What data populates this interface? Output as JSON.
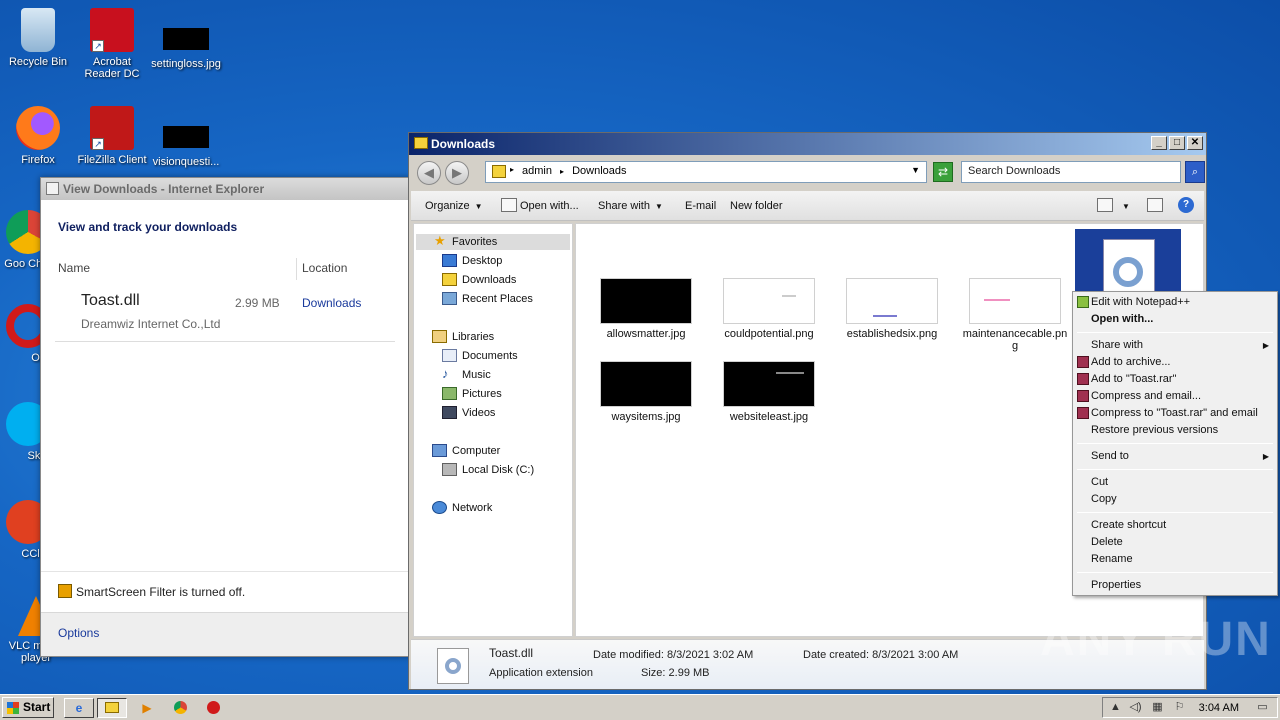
{
  "desktop": {
    "icons": [
      {
        "label": "Recycle Bin"
      },
      {
        "label": "Acrobat Reader DC"
      },
      {
        "label": "settingloss.jpg"
      },
      {
        "label": "Firefox"
      },
      {
        "label": "FileZilla Client"
      },
      {
        "label": "visionquesti..."
      },
      {
        "label": "Goo Chro"
      },
      {
        "label": "Ope"
      },
      {
        "label": "Skyp"
      },
      {
        "label": "CClea"
      },
      {
        "label": "VLC media player"
      }
    ]
  },
  "ie_window": {
    "title": "View Downloads - Internet Explorer",
    "heading": "View and track your downloads",
    "col_name": "Name",
    "col_location": "Location",
    "item": {
      "name": "Toast.dll",
      "size": "2.99 MB",
      "location": "Downloads",
      "publisher": "Dreamwiz Internet Co.,Ltd"
    },
    "smartscreen": "SmartScreen Filter is turned off.",
    "options": "Options"
  },
  "explorer": {
    "title": "Downloads",
    "breadcrumb": [
      "admin",
      "Downloads"
    ],
    "search_placeholder": "Search Downloads",
    "toolbar": {
      "organize": "Organize",
      "open_with": "Open with...",
      "share_with": "Share with",
      "email": "E-mail",
      "new_folder": "New folder"
    },
    "nav": {
      "favorites": "Favorites",
      "desktop": "Desktop",
      "downloads": "Downloads",
      "recent": "Recent Places",
      "libraries": "Libraries",
      "documents": "Documents",
      "music": "Music",
      "pictures": "Pictures",
      "videos": "Videos",
      "computer": "Computer",
      "local_disk": "Local Disk (C:)",
      "network": "Network"
    },
    "files": [
      {
        "name": "allowsmatter.jpg"
      },
      {
        "name": "couldpotential.png"
      },
      {
        "name": "establishedsix.png"
      },
      {
        "name": "maintenancecable.png"
      },
      {
        "name": "waysitems.jpg"
      },
      {
        "name": "websiteleast.jpg"
      }
    ],
    "details": {
      "name": "Toast.dll",
      "type": "Application extension",
      "modified_label": "Date modified:",
      "modified": "8/3/2021 3:02 AM",
      "created_label": "Date created:",
      "created": "8/3/2021 3:00 AM",
      "size_label": "Size:",
      "size": "2.99 MB"
    }
  },
  "context_menu": {
    "items": [
      {
        "label": "Edit with Notepad++"
      },
      {
        "label": "Open with..."
      },
      {
        "label": "Share with"
      },
      {
        "label": "Add to archive..."
      },
      {
        "label": "Add to \"Toast.rar\""
      },
      {
        "label": "Compress and email..."
      },
      {
        "label": "Compress to \"Toast.rar\" and email"
      },
      {
        "label": "Restore previous versions"
      },
      {
        "label": "Send to"
      },
      {
        "label": "Cut"
      },
      {
        "label": "Copy"
      },
      {
        "label": "Create shortcut"
      },
      {
        "label": "Delete"
      },
      {
        "label": "Rename"
      },
      {
        "label": "Properties"
      }
    ]
  },
  "taskbar": {
    "start": "Start",
    "clock": "3:04 AM"
  },
  "watermark": "ANY RUN"
}
